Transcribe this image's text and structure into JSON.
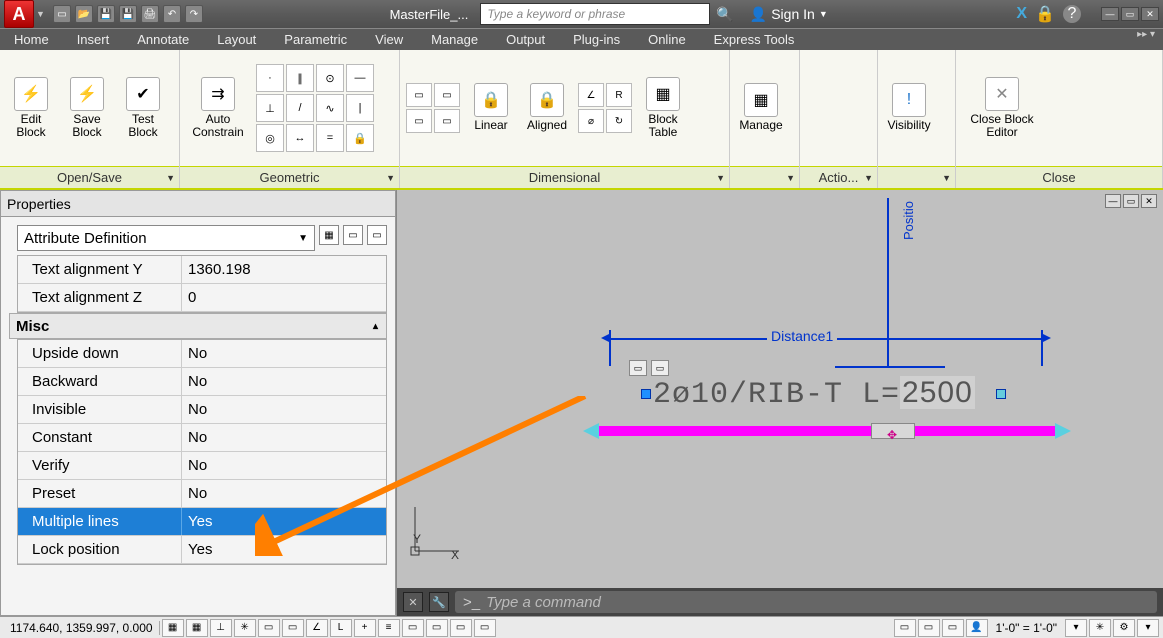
{
  "titlebar": {
    "doc_title": "MasterFile_...",
    "search_placeholder": "Type a keyword or phrase",
    "signin": "Sign In"
  },
  "tabs": [
    "Home",
    "Insert",
    "Annotate",
    "Layout",
    "Parametric",
    "View",
    "Manage",
    "Output",
    "Plug-ins",
    "Online",
    "Express Tools"
  ],
  "ribbon": {
    "panels": {
      "opensave": {
        "title": "Open/Save",
        "edit": "Edit Block",
        "save": "Save Block",
        "test": "Test Block"
      },
      "geometric": {
        "title": "Geometric",
        "auto": "Auto Constrain"
      },
      "dimensional": {
        "title": "Dimensional",
        "linear": "Linear",
        "aligned": "Aligned",
        "blocktable": "Block Table"
      },
      "manage": "Manage",
      "action": "Actio...",
      "visibility": "Visibility",
      "close": {
        "title": "Close",
        "btn": "Close Block Editor"
      }
    }
  },
  "properties": {
    "header": "Properties",
    "combo": "Attribute Definition",
    "rows_top": [
      {
        "k": "Text alignment Y",
        "v": "1360.198"
      },
      {
        "k": "Text alignment Z",
        "v": "0"
      }
    ],
    "section": "Misc",
    "rows_misc": [
      {
        "k": "Upside down",
        "v": "No"
      },
      {
        "k": "Backward",
        "v": "No"
      },
      {
        "k": "Invisible",
        "v": "No"
      },
      {
        "k": "Constant",
        "v": "No"
      },
      {
        "k": "Verify",
        "v": "No"
      },
      {
        "k": "Preset",
        "v": "No"
      },
      {
        "k": "Multiple lines",
        "v": "Yes",
        "sel": true
      },
      {
        "k": "Lock position",
        "v": "Yes"
      }
    ]
  },
  "drawing": {
    "dim_label": "Distance1",
    "pos_label": "Positio",
    "rebar_text": "2ø10/RIB-T L=2500",
    "rebar_value": "2500",
    "ucs_x": "X",
    "ucs_y": "Y"
  },
  "cmdline": {
    "placeholder": "Type a command"
  },
  "status": {
    "coords": "1174.640, 1359.997, 0.000",
    "scale": "1'-0\" = 1'-0\""
  }
}
